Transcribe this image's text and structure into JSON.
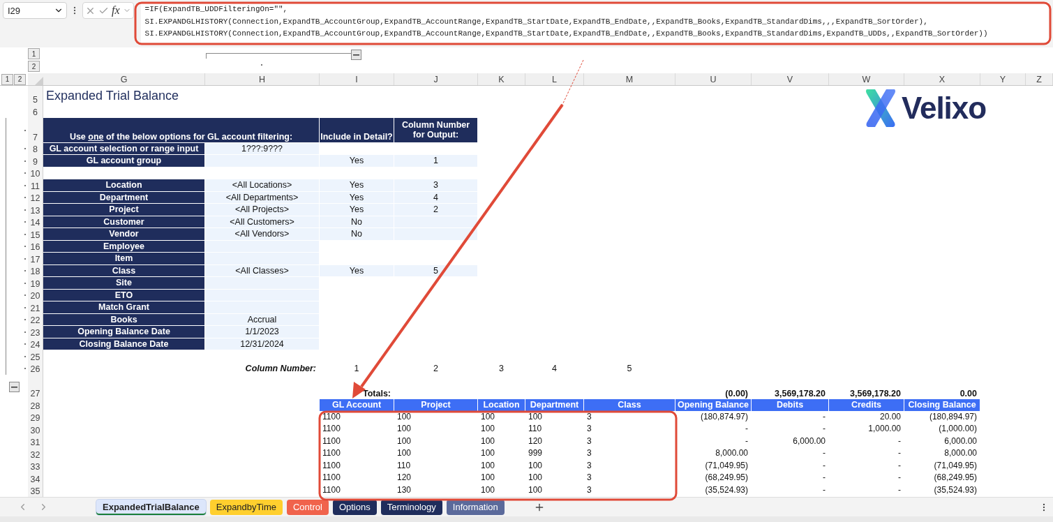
{
  "formula_bar": {
    "name_box": "I29",
    "function_label": "fx",
    "formula_lines": [
      "=IF(ExpandTB_UDDFilteringOn=\"\",",
      "SI.EXPANDGLHISTORY(Connection,ExpandTB_AccountGroup,ExpandTB_AccountRange,ExpandTB_StartDate,ExpandTB_EndDate,,ExpandTB_Books,ExpandTB_StandardDims,,,ExpandTB_SortOrder),",
      "SI.EXPANDGLHISTORY(Connection,ExpandTB_AccountGroup,ExpandTB_AccountRange,ExpandTB_StartDate,ExpandTB_EndDate,,ExpandTB_Books,ExpandTB_StandardDims,ExpandTB_UDDs,,ExpandTB_SortOrder))"
    ]
  },
  "outline": {
    "column_levels": [
      "1",
      "2"
    ],
    "row_levels": [
      "1",
      "2"
    ]
  },
  "columns": [
    "G",
    "H",
    "I",
    "J",
    "K",
    "L",
    "M",
    "U",
    "V",
    "W",
    "X",
    "Y",
    "Z"
  ],
  "logo": {
    "text": "Velixo"
  },
  "sheet_rows": [
    {
      "row": "5",
      "kind": "title",
      "grouped": false,
      "text": "Expanded Trial Balance"
    },
    {
      "row": "6",
      "kind": "blank",
      "grouped": false
    },
    {
      "row": "7",
      "kind": "filter_header",
      "grouped": true,
      "label_parts": [
        "Use ",
        "one",
        " of the below options for GL account filtering:"
      ],
      "include": "Include in Detail?",
      "column_number": "Column Number for Output:"
    },
    {
      "row": "8",
      "kind": "filter",
      "grouped": true,
      "label": "GL account selection or range input",
      "value": "1???:9???"
    },
    {
      "row": "9",
      "kind": "filter",
      "grouped": true,
      "label": "GL account group",
      "include": "Yes",
      "column_number": "1"
    },
    {
      "row": "10",
      "kind": "blank",
      "grouped": true
    },
    {
      "row": "11",
      "kind": "filter",
      "grouped": true,
      "label": "Location",
      "value": "<All Locations>",
      "include": "Yes",
      "column_number": "3"
    },
    {
      "row": "12",
      "kind": "filter",
      "grouped": true,
      "label": "Department",
      "value": "<All Departments>",
      "include": "Yes",
      "column_number": "4"
    },
    {
      "row": "13",
      "kind": "filter",
      "grouped": true,
      "label": "Project",
      "value": "<All Projects>",
      "include": "Yes",
      "column_number": "2"
    },
    {
      "row": "14",
      "kind": "filter",
      "grouped": true,
      "label": "Customer",
      "value": "<All Customers>",
      "include": "No"
    },
    {
      "row": "15",
      "kind": "filter",
      "grouped": true,
      "label": "Vendor",
      "value": "<All Vendors>",
      "include": "No"
    },
    {
      "row": "16",
      "kind": "filter",
      "grouped": true,
      "label": "Employee"
    },
    {
      "row": "17",
      "kind": "filter",
      "grouped": true,
      "label": "Item"
    },
    {
      "row": "18",
      "kind": "filter",
      "grouped": true,
      "label": "Class",
      "value": "<All Classes>",
      "include": "Yes",
      "column_number": "5"
    },
    {
      "row": "19",
      "kind": "filter",
      "grouped": true,
      "label": "Site"
    },
    {
      "row": "20",
      "kind": "filter",
      "grouped": true,
      "label": "ETO"
    },
    {
      "row": "21",
      "kind": "filter",
      "grouped": true,
      "label": "Match Grant"
    },
    {
      "row": "22",
      "kind": "filter",
      "grouped": true,
      "label": "Books",
      "value": "Accrual"
    },
    {
      "row": "23",
      "kind": "filter",
      "grouped": true,
      "label": "Opening Balance Date",
      "value": "1/1/2023"
    },
    {
      "row": "24",
      "kind": "filter",
      "grouped": true,
      "label": "Closing Balance Date",
      "value": "12/31/2024"
    },
    {
      "row": "25",
      "kind": "blank",
      "grouped": true
    },
    {
      "row": "26",
      "kind": "column_numbers",
      "grouped": true,
      "label": "Column Number:",
      "numbers": [
        "1",
        "2",
        "3",
        "4",
        "5"
      ]
    },
    {
      "row": "27",
      "kind": "totals",
      "grouped": false,
      "label": "Totals:",
      "values": [
        "(0.00)",
        "3,569,178.20",
        "3,569,178.20",
        "0.00"
      ]
    },
    {
      "row": "28",
      "kind": "table_header",
      "grouped": false,
      "cells": [
        "GL Account",
        "Project",
        "Location",
        "Department",
        "Class",
        "Opening Balance",
        "Debits",
        "Credits",
        "Closing Balance"
      ]
    },
    {
      "row": "29",
      "kind": "data",
      "grouped": false,
      "cells": [
        "1100",
        "100",
        "100",
        "100",
        "3",
        "(180,874.97)",
        "-",
        "20.00",
        "(180,894.97)"
      ]
    },
    {
      "row": "30",
      "kind": "data",
      "grouped": false,
      "cells": [
        "1100",
        "100",
        "100",
        "110",
        "3",
        "-",
        "-",
        "1,000.00",
        "(1,000.00)"
      ]
    },
    {
      "row": "31",
      "kind": "data",
      "grouped": false,
      "cells": [
        "1100",
        "100",
        "100",
        "120",
        "3",
        "-",
        "6,000.00",
        "-",
        "6,000.00"
      ]
    },
    {
      "row": "32",
      "kind": "data",
      "grouped": false,
      "cells": [
        "1100",
        "100",
        "100",
        "999",
        "3",
        "8,000.00",
        "-",
        "-",
        "8,000.00"
      ]
    },
    {
      "row": "33",
      "kind": "data",
      "grouped": false,
      "cells": [
        "1100",
        "110",
        "100",
        "100",
        "3",
        "(71,049.95)",
        "-",
        "-",
        "(71,049.95)"
      ]
    },
    {
      "row": "34",
      "kind": "data",
      "grouped": false,
      "cells": [
        "1100",
        "120",
        "100",
        "100",
        "3",
        "(68,249.95)",
        "-",
        "-",
        "(68,249.95)"
      ]
    },
    {
      "row": "35",
      "kind": "data",
      "grouped": false,
      "cells": [
        "1100",
        "130",
        "100",
        "100",
        "3",
        "(35,524.93)",
        "-",
        "-",
        "(35,524.93)"
      ]
    }
  ],
  "sheet_tabs": [
    {
      "label": "ExpandedTrialBalance",
      "selected": true,
      "color": "#dce6fb"
    },
    {
      "label": "ExpandbyTime",
      "selected": false,
      "color": "#ffcf2e"
    },
    {
      "label": "Control",
      "selected": false,
      "color": "#f0634c"
    },
    {
      "label": "Options",
      "selected": false,
      "color": "#1f2d5c"
    },
    {
      "label": "Terminology",
      "selected": false,
      "color": "#1f2d5c"
    },
    {
      "label": "Information",
      "selected": false,
      "color": "#5b6a9b"
    }
  ]
}
